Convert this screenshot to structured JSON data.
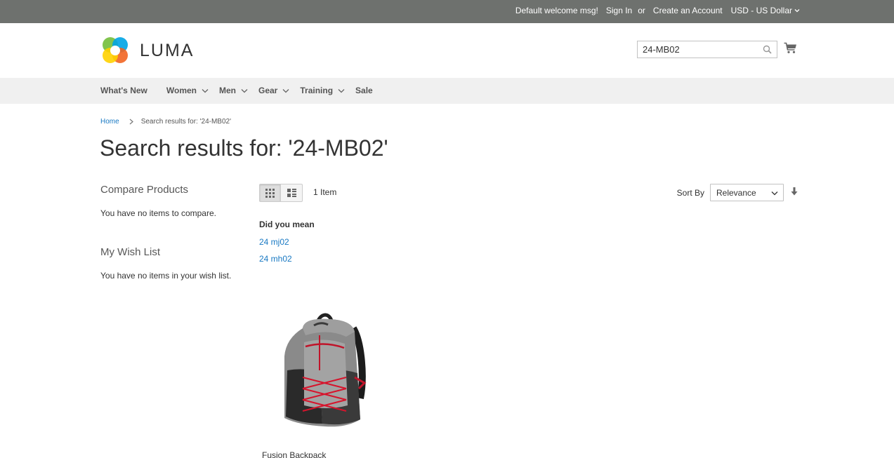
{
  "topbar": {
    "welcome": "Default welcome msg!",
    "sign_in": "Sign In",
    "or": "or",
    "create_account": "Create an Account",
    "currency": "USD - US Dollar"
  },
  "header": {
    "logo_text": "LUMA",
    "search_value": "24-MB02"
  },
  "nav": {
    "items": [
      {
        "label": "What's New"
      },
      {
        "label": "Women"
      },
      {
        "label": "Men"
      },
      {
        "label": "Gear"
      },
      {
        "label": "Training"
      },
      {
        "label": "Sale"
      }
    ]
  },
  "breadcrumb": {
    "home": "Home",
    "current": "Search results for: '24-MB02'"
  },
  "page_title": "Search results for: '24-MB02'",
  "sidebar": {
    "compare_title": "Compare Products",
    "compare_empty": "You have no items to compare.",
    "wishlist_title": "My Wish List",
    "wishlist_empty": "You have no items in your wish list."
  },
  "toolbar": {
    "amount": "1 Item",
    "sort_label": "Sort By",
    "sort_value": "Relevance"
  },
  "did_you_mean": {
    "title": "Did you mean",
    "suggestions": [
      "24 mj02",
      "24 mh02"
    ]
  },
  "products": [
    {
      "name": "Fusion Backpack"
    }
  ],
  "colors": {
    "topbar_bg": "#6e716e",
    "nav_bg": "#f0f0f0",
    "link": "#1979c3",
    "accent_red": "#e02b27"
  }
}
